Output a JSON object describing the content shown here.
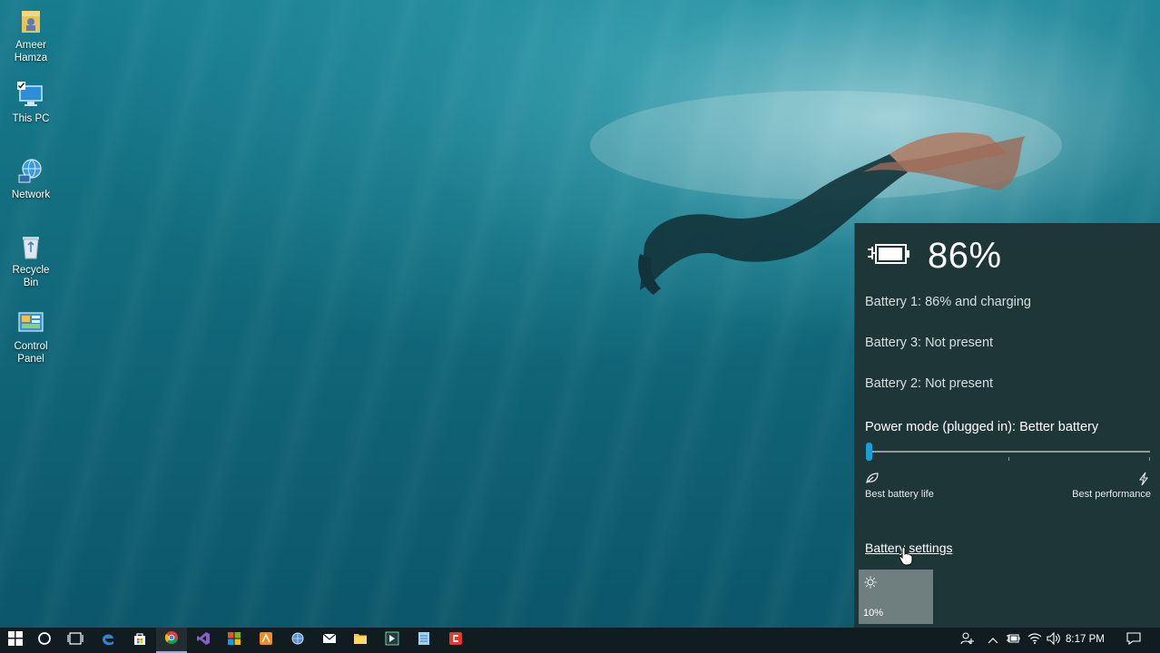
{
  "desktop": {
    "icons": [
      {
        "label": "Ameer Hamza",
        "icon": "user-folder-icon"
      },
      {
        "label": "This PC",
        "icon": "computer-icon"
      },
      {
        "label": "Network",
        "icon": "network-icon"
      },
      {
        "label": "Recycle Bin",
        "icon": "recycle-bin-icon"
      },
      {
        "label": "Control Panel",
        "icon": "control-panel-icon"
      }
    ]
  },
  "battery_flyout": {
    "percent": "86%",
    "battery1": "Battery 1: 86% and charging",
    "battery3": "Battery 3: Not present",
    "battery2": "Battery 2: Not present",
    "power_mode_title": "Power mode (plugged in): Better battery",
    "power_mode_level": 0,
    "left_label": "Best battery life",
    "right_label": "Best performance",
    "settings_link": "Battery settings",
    "brightness": "10%"
  },
  "taskbar": {
    "apps": [
      "start-icon",
      "cortana-icon",
      "task-view-icon",
      "edge-icon",
      "store-icon",
      "chrome-icon",
      "visual-studio-icon",
      "office-icon",
      "app-orange-icon",
      "app-globe-icon",
      "mail-icon",
      "file-explorer-icon",
      "app-dark-icon",
      "notepad-icon",
      "app-red-icon"
    ],
    "time": "8:17 PM"
  },
  "colors": {
    "flyout_bg": "#1f3638",
    "accent": "#1a9fd4",
    "taskbar_bg": "#101c20"
  }
}
